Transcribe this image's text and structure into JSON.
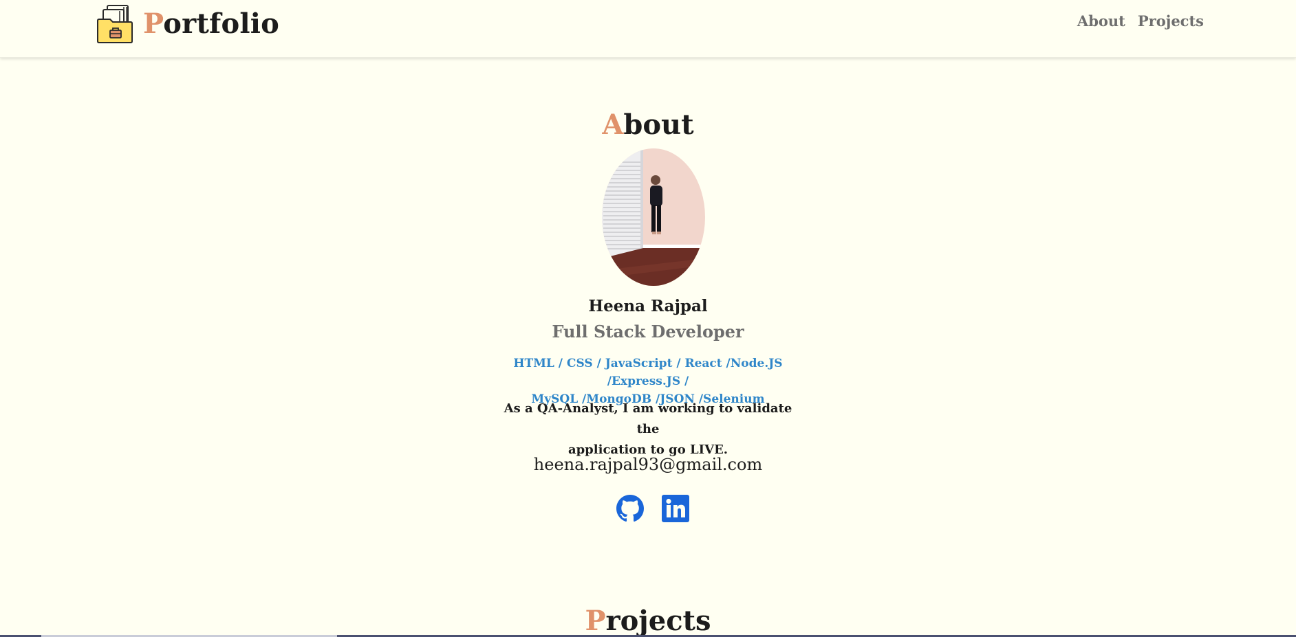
{
  "header": {
    "brand_first": "P",
    "brand_rest": "ortfolio",
    "nav": [
      {
        "label": "About"
      },
      {
        "label": "Projects"
      }
    ]
  },
  "about": {
    "title_first": "A",
    "title_rest": "bout",
    "name": "Heena Rajpal",
    "role": "Full Stack Developer",
    "skills_line1": "HTML / CSS / JavaScript / React /Node.JS /Express.JS /",
    "skills_line2": "MySQL /MongoDB /JSON /Selenium",
    "description_line1": "As a QA-Analyst, I am working to validate the",
    "description_line2": "application to go LIVE.",
    "email": "heena.rajpal93@gmail.com",
    "social": [
      {
        "icon": "github-icon"
      },
      {
        "icon": "linkedin-icon"
      }
    ]
  },
  "projects": {
    "title_first": "P",
    "title_rest": "rojects"
  },
  "colors": {
    "background": "#fffff2",
    "accent": "#e0926a",
    "skills": "#2f86c9",
    "nav": "#6e6e6e",
    "social": "#1a66d9"
  }
}
